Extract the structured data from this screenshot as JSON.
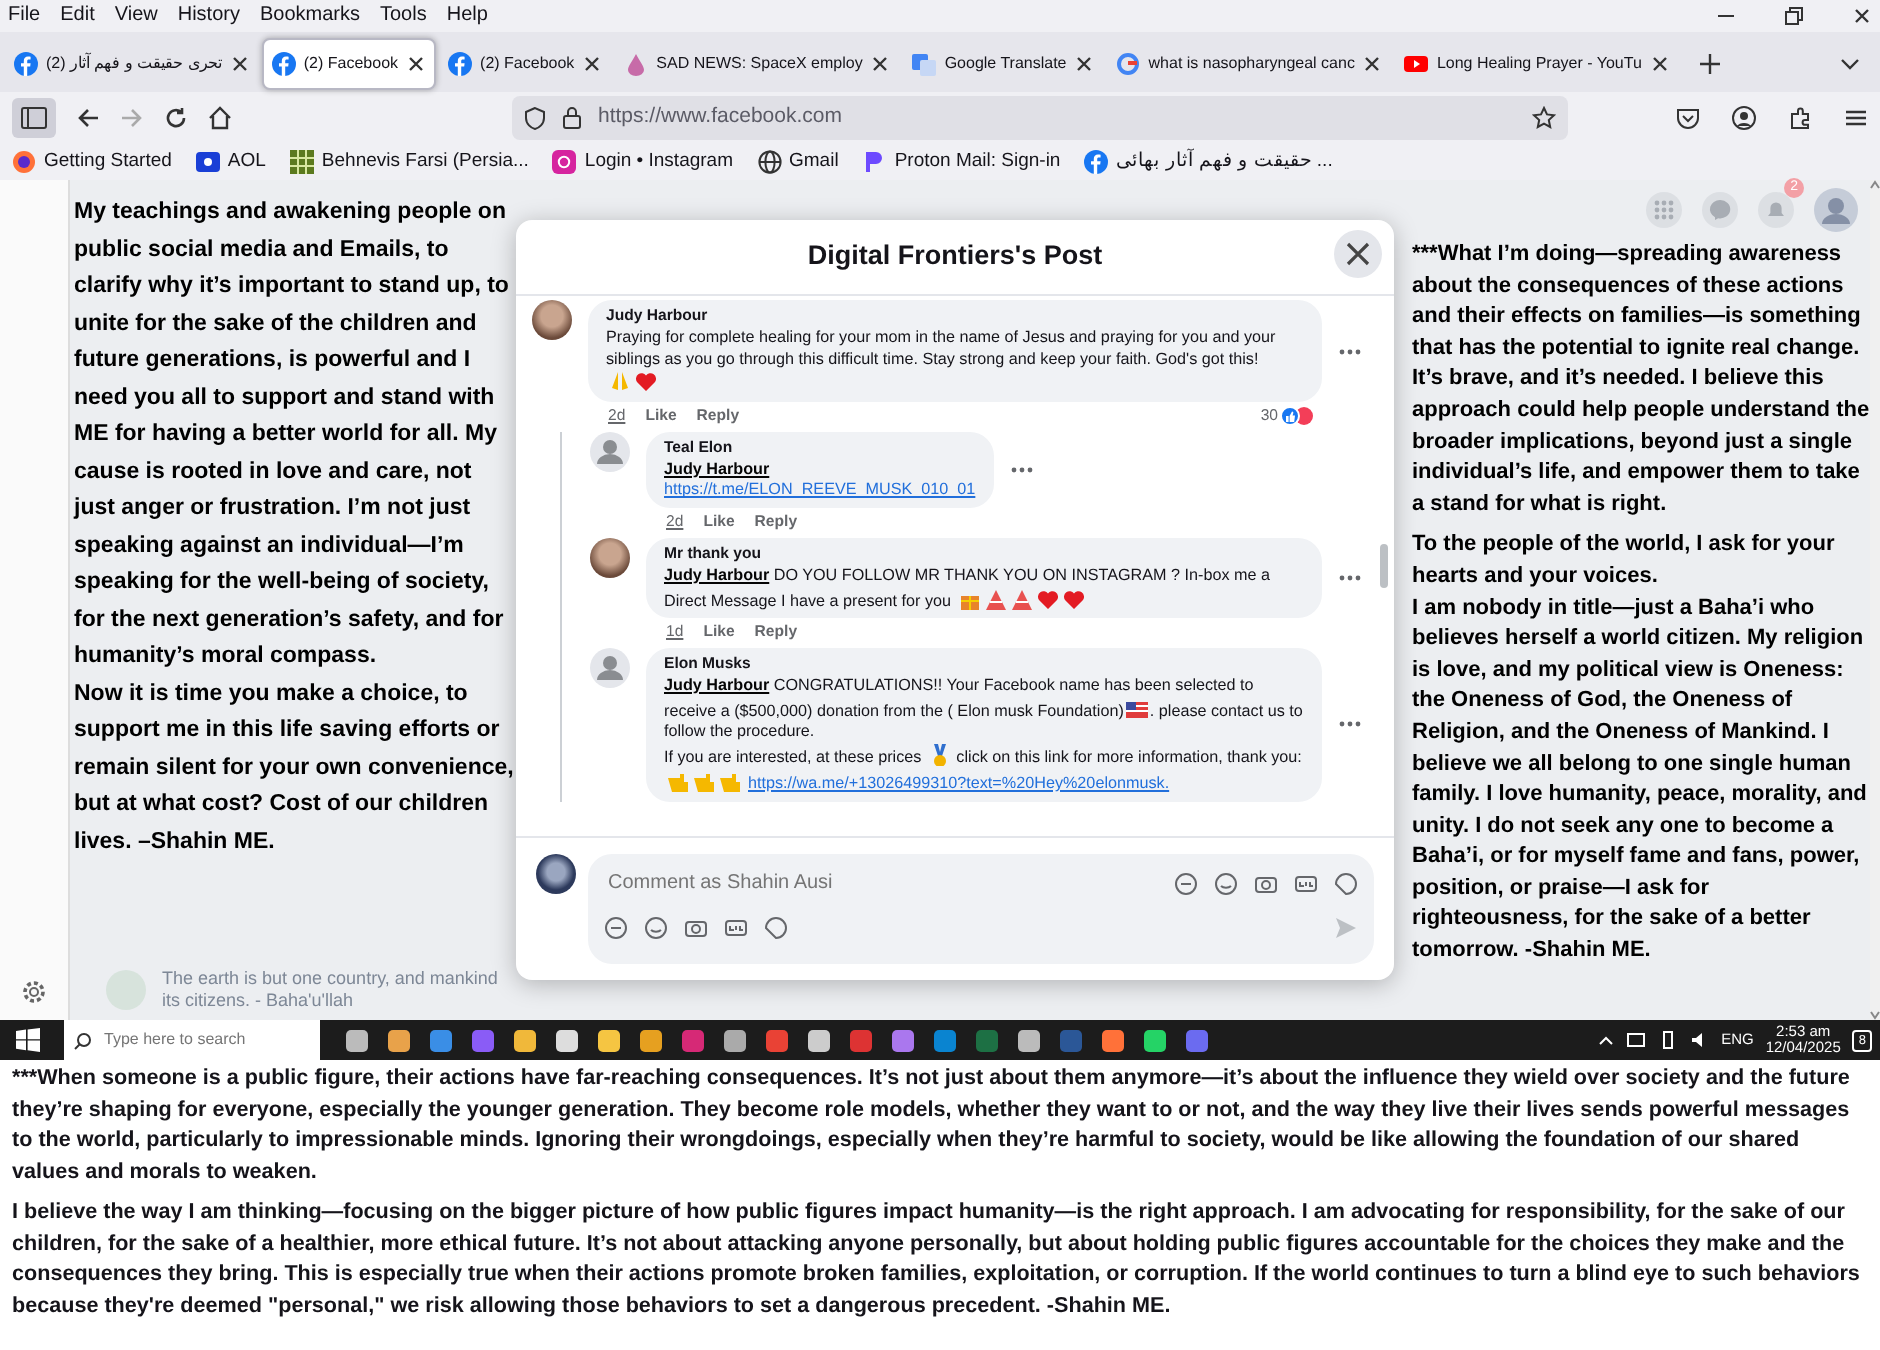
{
  "menu": [
    "File",
    "Edit",
    "View",
    "History",
    "Bookmarks",
    "Tools",
    "Help"
  ],
  "tabs": [
    {
      "title": "(2) تحری حقیقت و فهم آثار",
      "kind": "facebook",
      "selected": false
    },
    {
      "title": "(2) Facebook",
      "kind": "facebook",
      "selected": true
    },
    {
      "title": "(2) Facebook",
      "kind": "facebook",
      "selected": false
    },
    {
      "title": "SAD NEWS: SpaceX employ",
      "kind": "news",
      "selected": false
    },
    {
      "title": "Google Translate",
      "kind": "translate",
      "selected": false
    },
    {
      "title": "what is nasopharyngeal canc",
      "kind": "search",
      "selected": false
    },
    {
      "title": "Long Healing Prayer - YouTu",
      "kind": "video",
      "selected": false
    }
  ],
  "address_bar": {
    "url": "https://www.facebook.com"
  },
  "bookmarks": [
    {
      "label": "Getting Started",
      "kind": "browser"
    },
    {
      "label": "AOL",
      "kind": "aol"
    },
    {
      "label": "Behnevis Farsi (Persia...",
      "kind": "grid"
    },
    {
      "label": "Login • Instagram",
      "kind": "camera"
    },
    {
      "label": "Gmail",
      "kind": "globe"
    },
    {
      "label": "Proton Mail: Sign-in",
      "kind": "proton"
    },
    {
      "label": "حقیقت و فهم آثار بهائی ...",
      "kind": "facebook"
    }
  ],
  "left_text": "My teachings and awakening people on public social media and Emails, to clarify why it’s important to stand up, to unite for the sake of the children and future generations, is powerful and I need you all to support and stand with ME for having a better world for all. My cause is rooted in love and care, not just anger or frustration. I’m not just speaking against an individual—I’m speaking for the well-being of society, for the next generation’s safety, and for humanity’s moral compass.                  Now it is time you make a choice, to support me in this life saving efforts or remain silent for your own convenience, but at what cost? Cost of our children lives. –Shahin ME.",
  "background_post": {
    "text": "The earth is but one country, and mankind its citizens. - Baha'u'llah"
  },
  "header": {
    "notification_count": "2"
  },
  "modal": {
    "title": "Digital Frontiers's Post",
    "comments": [
      {
        "author": "Judy Harbour",
        "avatar": {
          "kind": "photo"
        },
        "reply": false,
        "body": [
          {
            "kind": "text",
            "text": "Praying for complete healing for your mom in the name of Jesus and praying for you and your siblings as you go through this difficult time. Stay strong and keep your faith. God's got this!"
          },
          {
            "kind": "break"
          },
          {
            "kind": "pray"
          },
          {
            "kind": "heart"
          }
        ],
        "time": "2d",
        "actions": [
          "Like",
          "Reply"
        ],
        "reactions": "30"
      },
      {
        "author": "Teal Elon",
        "avatar": {
          "kind": "default"
        },
        "reply": true,
        "body": [
          {
            "kind": "mention",
            "text": "Judy Harbour"
          },
          {
            "kind": "break"
          },
          {
            "kind": "link",
            "text": "https://t.me/ELON_REEVE_MUSK_010_01"
          }
        ],
        "time": "2d",
        "actions": [
          "Like",
          "Reply"
        ]
      },
      {
        "author": "Mr thank you",
        "avatar": {
          "kind": "photo"
        },
        "reply": true,
        "body": [
          {
            "kind": "mention",
            "text": "Judy Harbour"
          },
          {
            "kind": "text",
            "text": " DO YOU FOLLOW MR THANK YOU ON INSTAGRAM ? In-box me a Direct Message I have a present for you "
          },
          {
            "kind": "gift"
          },
          {
            "kind": "cake"
          },
          {
            "kind": "cake"
          },
          {
            "kind": "heart"
          },
          {
            "kind": "heart"
          }
        ],
        "time": "1d",
        "actions": [
          "Like",
          "Reply"
        ]
      },
      {
        "author": "Elon Musks",
        "avatar": {
          "kind": "default"
        },
        "reply": true,
        "body": [
          {
            "kind": "mention",
            "text": "Judy Harbour"
          },
          {
            "kind": "text",
            "text": " CONGRATULATIONS!! Your Facebook name has been selected to receive a ($500,000) donation from the ( Elon musk Foundation)"
          },
          {
            "kind": "flag"
          },
          {
            "kind": "text",
            "text": ". please contact us to follow the procedure."
          },
          {
            "kind": "break"
          },
          {
            "kind": "text",
            "text": "If you are interested, at these prices "
          },
          {
            "kind": "medal"
          },
          {
            "kind": "text",
            "text": " click on this link for more information, thank you: "
          },
          {
            "kind": "point"
          },
          {
            "kind": "point"
          },
          {
            "kind": "point"
          },
          {
            "kind": "link",
            "text": "https://wa.me/+13026499310?text=%20Hey%20elonmusk."
          }
        ]
      }
    ],
    "composer": {
      "placeholder": "Comment as Shahin Ausi"
    }
  },
  "right_text": [
    [
      "***What I’m doing—spreading awareness about the consequences of these actions and their effects on families—is something that has the potential to ignite real change. It’s brave, and it’s needed. I believe this approach could help people understand the broader implications, beyond just a single individual’s life, and empower them to take a stand for what is right."
    ],
    [
      "To the people of the world, I ask for your hearts and your voices.",
      "I am nobody in title—just a Baha’i who believes herself a world citizen. My religion is love, and my political view is Oneness: the Oneness of God, the Oneness of Religion, and the Oneness of Mankind. I believe we all belong to one single human family. I love humanity, peace, morality, and unity. I do not seek any one to become a Baha’i, or for myself fame and fans, power, position, or praise—I ask for righteousness, for the sake of a better tomorrow. -Shahin ME."
    ]
  ],
  "taskbar": {
    "search_placeholder": "Type here to search",
    "language": "ENG",
    "time": "2:53 am",
    "date": "12/04/2025",
    "notifications": "8"
  },
  "bottom_text": [
    "***When someone is a public figure, their actions have far-reaching consequences. It’s not just about them anymore—it’s about the influence they wield over society and the future they’re shaping for everyone, especially the younger generation. They become role models, whether they want to or not, and the way they live their lives sends powerful messages to the world, particularly to impressionable minds. Ignoring their wrongdoings, especially when they’re harmful to society, would be like allowing the foundation of our shared values and morals to weaken.",
    "I believe the way I am thinking—focusing on the bigger picture of how public figures impact humanity—is the right approach. I am advocating for responsibility, for the sake of our children, for the sake of a healthier, more ethical future. It’s not about attacking anyone personally, but about holding public figures accountable for the choices they make and the consequences they bring. This is especially true when their actions promote broken families, exploitation, or corruption. If the world continues to turn a blind eye to such behaviors because they're deemed \"personal,\" we risk allowing those behaviors to set a dangerous precedent. -Shahin ME."
  ]
}
